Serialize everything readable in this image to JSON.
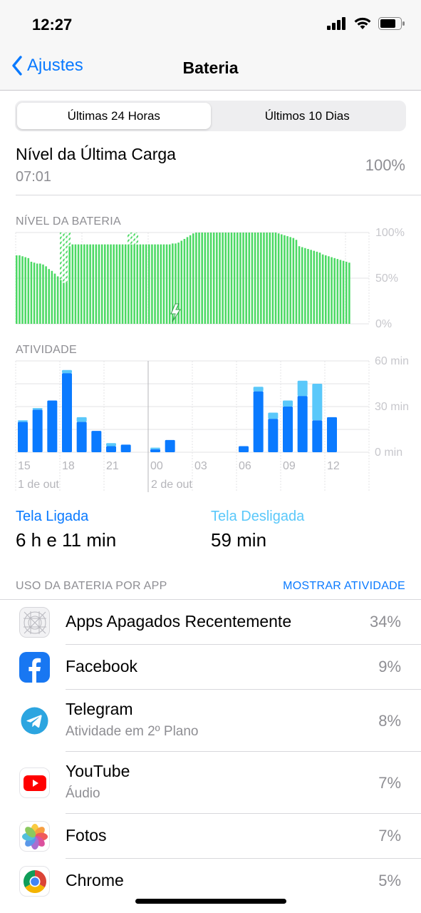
{
  "status": {
    "time": "12:27"
  },
  "nav": {
    "back_label": "Ajustes",
    "title": "Bateria"
  },
  "tabs": [
    {
      "label": "Últimas 24 Horas",
      "active": true
    },
    {
      "label": "Últimos 10 Dias",
      "active": false
    }
  ],
  "last_charge": {
    "title": "Nível da Última Carga",
    "time": "07:01",
    "value": "100%"
  },
  "battery_section": {
    "label": "NÍVEL DA BATERIA"
  },
  "activity_section": {
    "label": "ATIVIDADE"
  },
  "chart_data": [
    {
      "type": "bar",
      "title": "NÍVEL DA BATERIA",
      "y_tick_labels": [
        "100%",
        "50%",
        "0%"
      ],
      "ylim": [
        0,
        100
      ],
      "values": [
        75,
        75,
        74,
        73,
        72,
        68,
        67,
        66,
        66,
        65,
        63,
        60,
        58,
        55,
        52,
        48,
        45,
        45,
        85,
        87,
        87,
        87,
        87,
        87,
        87,
        87,
        87,
        87,
        87,
        87,
        87,
        87,
        87,
        87,
        87,
        87,
        87,
        87,
        87,
        87,
        87,
        87,
        87,
        87,
        87,
        87,
        87,
        87,
        87,
        87,
        87,
        87,
        87,
        88,
        88,
        89,
        91,
        93,
        95,
        97,
        99,
        100,
        100,
        100,
        100,
        100,
        100,
        100,
        100,
        100,
        100,
        100,
        100,
        100,
        100,
        100,
        100,
        100,
        100,
        100,
        100,
        100,
        100,
        100,
        100,
        100,
        100,
        100,
        100,
        99,
        98,
        97,
        96,
        95,
        94,
        92,
        85,
        84,
        83,
        82,
        81,
        80,
        79,
        78,
        76,
        75,
        74,
        73,
        72,
        71,
        70,
        69,
        68,
        67
      ],
      "hatched_ranges": [
        [
          15,
          18
        ],
        [
          38,
          41
        ]
      ],
      "color": "#4cd964",
      "grid": true
    },
    {
      "type": "bar",
      "title": "ATIVIDADE",
      "categories": [
        "15",
        "16",
        "17",
        "18",
        "19",
        "20",
        "21",
        "22",
        "23",
        "00",
        "01",
        "02",
        "03",
        "04",
        "05",
        "06",
        "07",
        "08",
        "09",
        "10",
        "11",
        "12"
      ],
      "x_tick_labels": [
        "15",
        "18",
        "21",
        "00",
        "03",
        "06",
        "09",
        "12"
      ],
      "date_labels": [
        "1 de out",
        "2 de out"
      ],
      "y_tick_labels": [
        "60 min",
        "30 min",
        "0 min"
      ],
      "ylim": [
        0,
        60
      ],
      "series": [
        {
          "name": "Tela Ligada",
          "color": "#0a7aff",
          "values": [
            20,
            28,
            34,
            52,
            20,
            14,
            4,
            5,
            0,
            2,
            8,
            0,
            0,
            0,
            0,
            4,
            40,
            22,
            30,
            37,
            21,
            23
          ]
        },
        {
          "name": "Tela Desligada",
          "color": "#5ac8fa",
          "values": [
            1,
            1,
            0,
            2,
            3,
            0,
            2,
            0,
            0,
            1,
            0,
            0,
            0,
            0,
            0,
            0,
            3,
            4,
            4,
            10,
            24,
            0
          ]
        }
      ],
      "grid": true
    }
  ],
  "usage": {
    "screen_on": {
      "label": "Tela Ligada",
      "value": "6 h e 11 min"
    },
    "screen_off": {
      "label": "Tela Desligada",
      "value": "59 min"
    }
  },
  "apps_section": {
    "label": "USO DA BATERIA POR APP",
    "action": "MOSTRAR ATIVIDADE"
  },
  "apps": [
    {
      "name": "Apps Apagados Recentemente",
      "sub": "",
      "pct": "34%",
      "icon": "deleted-apps-icon"
    },
    {
      "name": "Facebook",
      "sub": "",
      "pct": "9%",
      "icon": "facebook-icon"
    },
    {
      "name": "Telegram",
      "sub": "Atividade em 2º Plano",
      "pct": "8%",
      "icon": "telegram-icon"
    },
    {
      "name": "YouTube",
      "sub": "Áudio",
      "pct": "7%",
      "icon": "youtube-icon"
    },
    {
      "name": "Fotos",
      "sub": "",
      "pct": "7%",
      "icon": "photos-icon"
    },
    {
      "name": "Chrome",
      "sub": "",
      "pct": "5%",
      "icon": "chrome-icon"
    }
  ],
  "colors": {
    "accent": "#0a7aff",
    "battery": "#4cd964",
    "screen_on": "#0a7aff",
    "screen_off": "#5ac8fa"
  }
}
